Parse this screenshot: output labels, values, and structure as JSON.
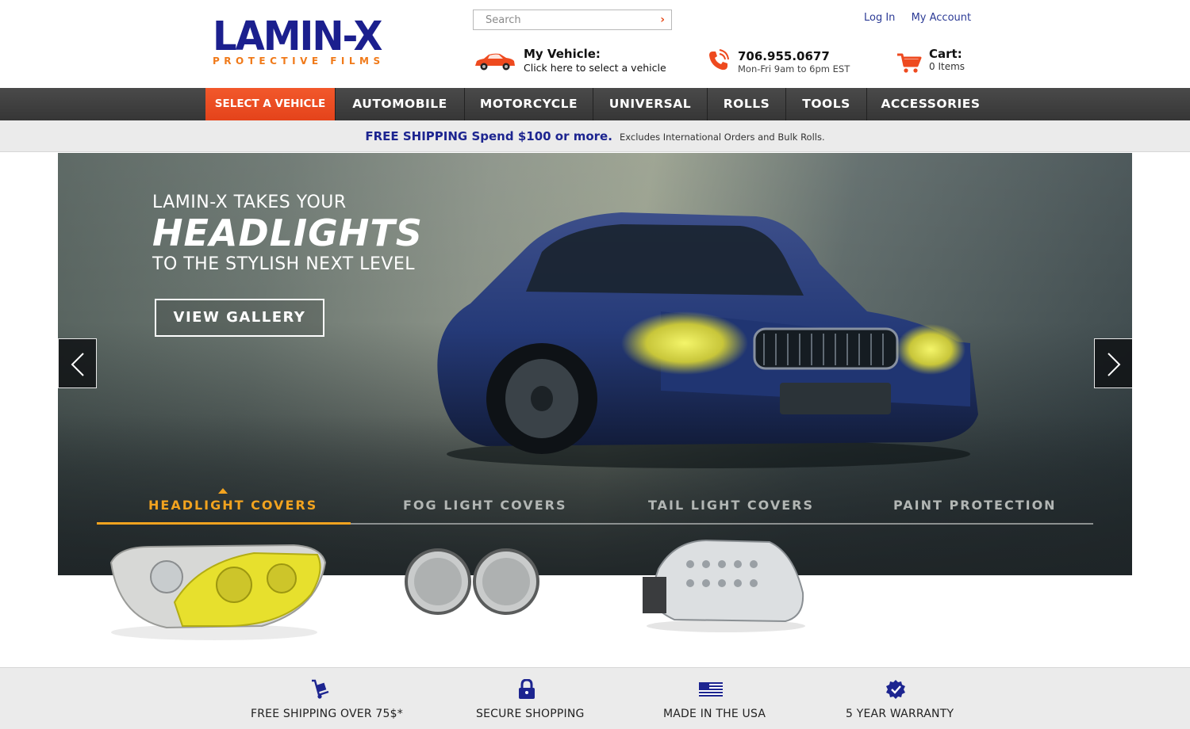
{
  "brand": {
    "logo_text": "LAMIN-X",
    "tagline": "PROTECTIVE FILMS",
    "colors": {
      "primary": "#1b1f8e",
      "accent": "#f07a1a",
      "nav_active": "#e74c1c",
      "tab_active": "#f2a31f"
    }
  },
  "header": {
    "search_placeholder": "Search",
    "login": "Log In",
    "my_account": "My Account",
    "vehicle_title": "My Vehicle:",
    "vehicle_sub": "Click here to select a vehicle",
    "phone": "706.955.0677",
    "hours": "Mon-Fri 9am to 6pm EST",
    "cart_label": "Cart:",
    "cart_items": "0 Items"
  },
  "nav": {
    "items": [
      "SELECT A VEHICLE",
      "AUTOMOBILE",
      "MOTORCYCLE",
      "UNIVERSAL",
      "ROLLS",
      "TOOLS",
      "ACCESSORIES"
    ]
  },
  "shipping_bar": {
    "strong": "FREE SHIPPING Spend $100 or more.",
    "small": "Excludes International Orders and Bulk Rolls."
  },
  "hero": {
    "line1": "LAMIN-X TAKES YOUR",
    "line2": "HEADLIGHTS",
    "line3": "TO THE STYLISH NEXT LEVEL",
    "cta": "VIEW GALLERY",
    "tabs": [
      "HEADLIGHT COVERS",
      "FOG LIGHT COVERS",
      "TAIL LIGHT COVERS",
      "PAINT PROTECTION"
    ],
    "active_tab": "HEADLIGHT COVERS"
  },
  "features": [
    {
      "label": "FREE SHIPPING OVER 75$*",
      "icon": "hand-truck-icon"
    },
    {
      "label": "SECURE SHOPPING",
      "icon": "padlock-icon"
    },
    {
      "label": "MADE IN THE USA",
      "icon": "us-flag-icon"
    },
    {
      "label": "5 YEAR WARRANTY",
      "icon": "check-badge-icon"
    }
  ]
}
